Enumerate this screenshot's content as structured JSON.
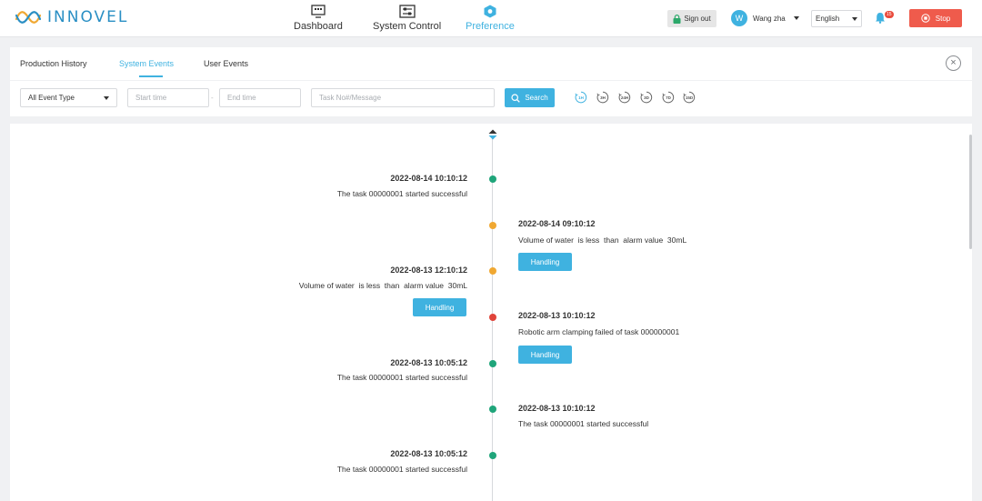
{
  "app": {
    "name": "INNOVEL"
  },
  "nav": [
    {
      "label": "Dashboard",
      "icon": "dashboard-icon"
    },
    {
      "label": "System Control",
      "icon": "system-control-icon"
    },
    {
      "label": "Preference",
      "icon": "preference-icon",
      "active": true
    }
  ],
  "header": {
    "signout_label": "Sign out",
    "user": {
      "initial": "W",
      "name": "Wang zha"
    },
    "language": "English",
    "notification_count": "15",
    "stop_label": "Stop"
  },
  "tabs": [
    {
      "label": "Production History"
    },
    {
      "label": "System Events",
      "active": true
    },
    {
      "label": "User Events"
    }
  ],
  "filters": {
    "event_type": "All Event Type",
    "start_placeholder": "Start time",
    "end_placeholder": "End time",
    "task_placeholder": "Task No#/Message",
    "search_label": "Search",
    "ranges": [
      "1H",
      "3H",
      "24H",
      "3D",
      "7D",
      "15D"
    ]
  },
  "events": [
    {
      "side": "left",
      "time": "2022-08-14 10:10:12",
      "message": "The task 00000001 started successful",
      "status": "green"
    },
    {
      "side": "right",
      "time": "2022-08-14 09:10:12",
      "message": "Volume of water  is less  than  alarm value  30mL",
      "status": "orange",
      "action": "Handling"
    },
    {
      "side": "left",
      "time": "2022-08-13 12:10:12",
      "message": "Volume of water  is less  than  alarm value  30mL",
      "status": "orange",
      "action": "Handling"
    },
    {
      "side": "right",
      "time": "2022-08-13 10:10:12",
      "message": "Robotic arm clamping failed of task 000000001",
      "status": "red",
      "action": "Handling"
    },
    {
      "side": "left",
      "time": "2022-08-13 10:05:12",
      "message": "The task 00000001 started successful",
      "status": "green"
    },
    {
      "side": "right",
      "time": "2022-08-13 10:10:12",
      "message": "The task 00000001 started successful",
      "status": "green"
    },
    {
      "side": "left",
      "time": "2022-08-13 10:05:12",
      "message": "The task 00000001 started successful",
      "status": "green"
    }
  ],
  "colors": {
    "accent": "#3fb2e0",
    "stop": "#ef5b4c",
    "status_green": "#1fa57a",
    "status_orange": "#f0a832",
    "status_red": "#e0443a"
  }
}
